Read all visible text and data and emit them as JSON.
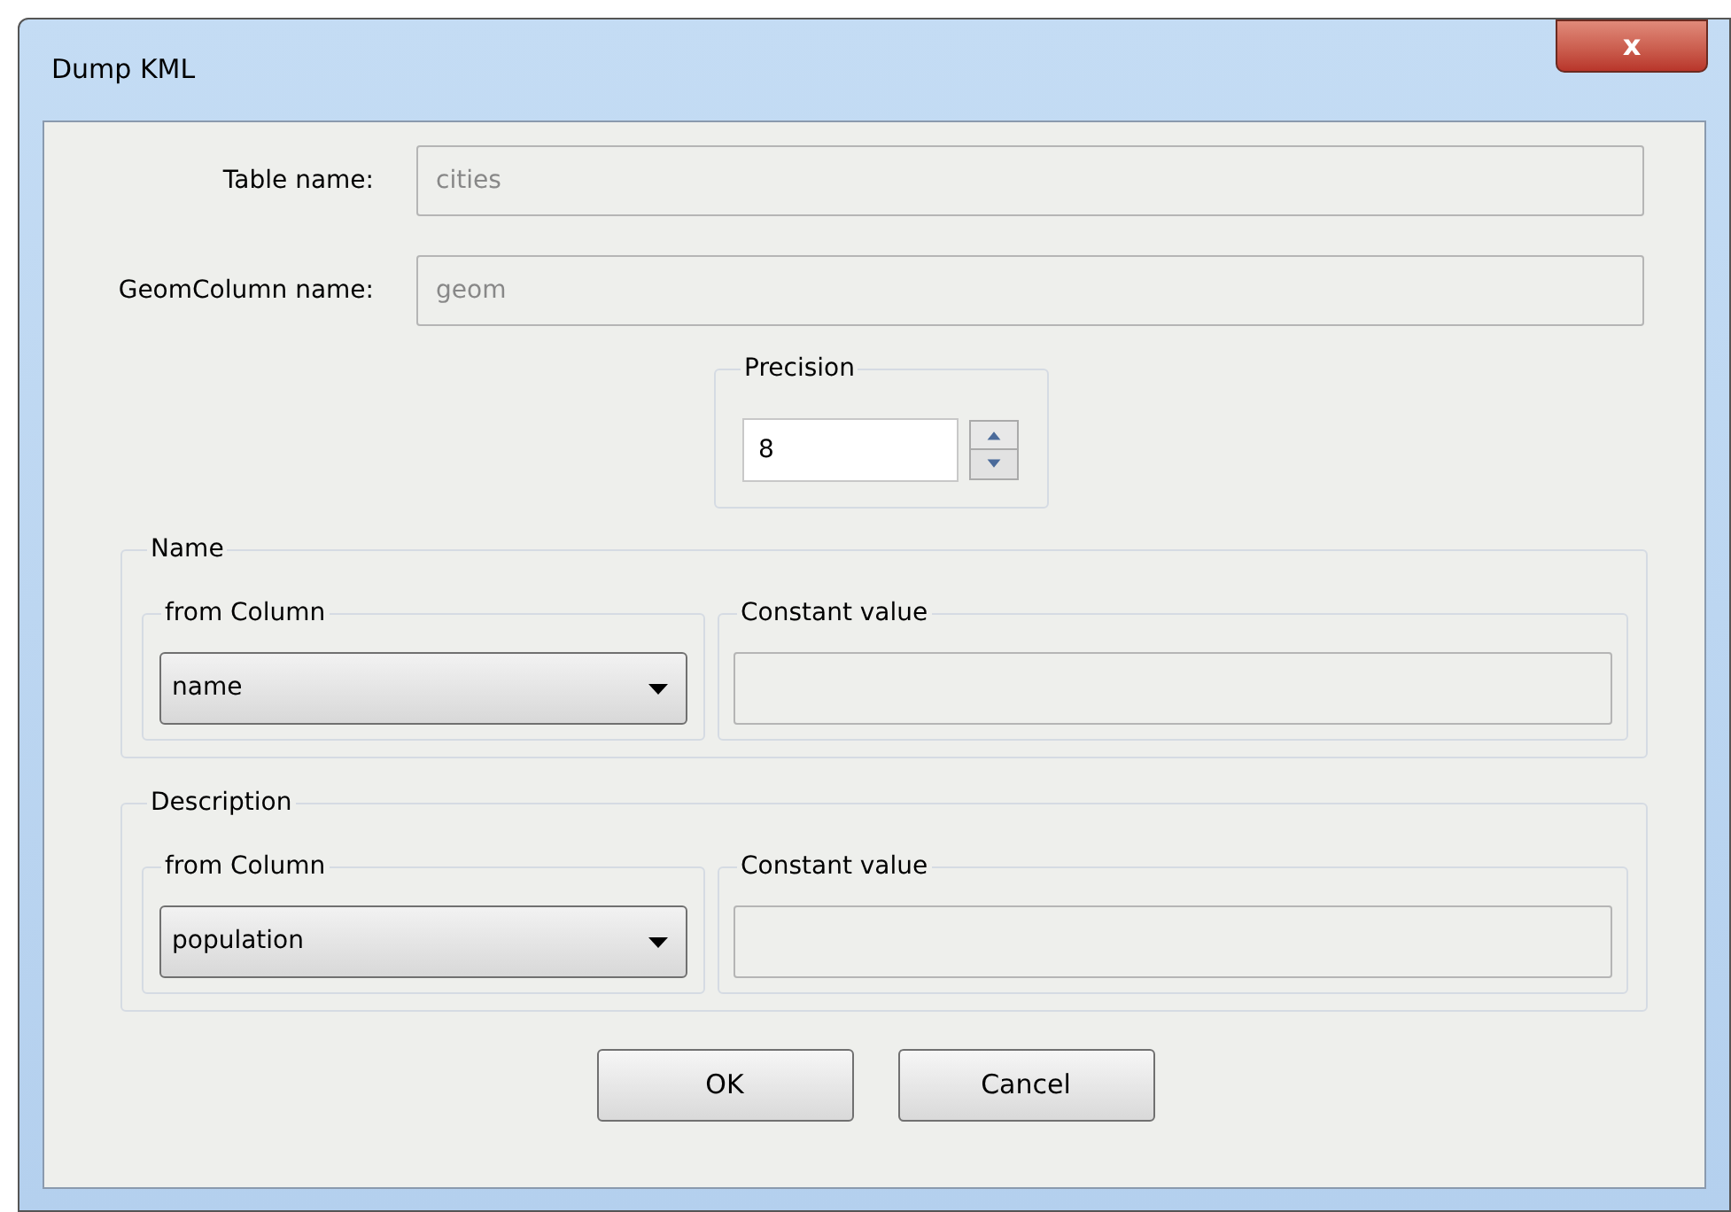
{
  "window": {
    "title": "Dump KML",
    "close": "x"
  },
  "fields": [
    {
      "label": "Table name:",
      "value": "cities",
      "disabled": true
    },
    {
      "label": "GeomColumn name:",
      "value": "geom",
      "disabled": true
    }
  ],
  "precision": {
    "title": "Precision",
    "value": "8"
  },
  "groups": [
    {
      "title": "Name",
      "column_title": "from Column",
      "column_value": "name",
      "constant_title": "Constant value",
      "constant_disabled": true
    },
    {
      "title": "Description",
      "column_title": "from Column",
      "column_value": "population",
      "constant_title": "Constant value",
      "constant_disabled": true
    }
  ],
  "buttons": [
    "OK",
    "Cancel"
  ]
}
